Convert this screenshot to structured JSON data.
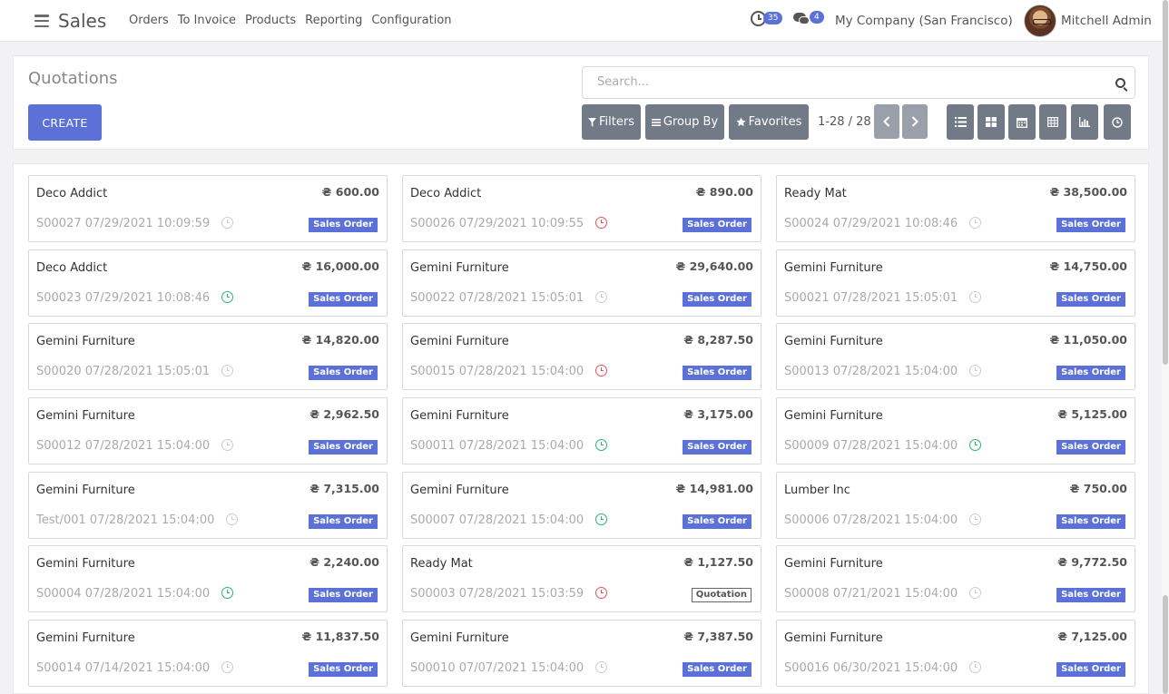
{
  "navbar": {
    "app_name": "Sales",
    "menu": [
      "Orders",
      "To Invoice",
      "Products",
      "Reporting",
      "Configuration"
    ],
    "activity_count": "35",
    "message_count": "4",
    "company": "My Company (San Francisco)",
    "user": "Mitchell Admin"
  },
  "control": {
    "title": "Quotations",
    "create_label": "CREATE",
    "search_placeholder": "Search...",
    "filters_label": "Filters",
    "group_by_label": "Group By",
    "favorites_label": "Favorites",
    "pager": "1-28 / 28"
  },
  "colors": {
    "primary": "#5b71d8",
    "overdue": "#e3545e",
    "planned": "#28b56f",
    "button_gray": "#727987"
  },
  "cards": [
    {
      "name": "Deco Addict",
      "amount": "₴ 600.00",
      "ref": "S00027 07/29/2021 10:09:59",
      "activity": "none",
      "status": "Sales Order"
    },
    {
      "name": "Deco Addict",
      "amount": "₴ 890.00",
      "ref": "S00026 07/29/2021 10:09:55",
      "activity": "overdue",
      "status": "Sales Order"
    },
    {
      "name": "Ready Mat",
      "amount": "₴ 38,500.00",
      "ref": "S00024 07/29/2021 10:08:46",
      "activity": "none",
      "status": "Sales Order"
    },
    {
      "name": "Deco Addict",
      "amount": "₴ 16,000.00",
      "ref": "S00023 07/29/2021 10:08:46",
      "activity": "planned",
      "status": "Sales Order"
    },
    {
      "name": "Gemini Furniture",
      "amount": "₴ 29,640.00",
      "ref": "S00022 07/28/2021 15:05:01",
      "activity": "none",
      "status": "Sales Order"
    },
    {
      "name": "Gemini Furniture",
      "amount": "₴ 14,750.00",
      "ref": "S00021 07/28/2021 15:05:01",
      "activity": "none",
      "status": "Sales Order"
    },
    {
      "name": "Gemini Furniture",
      "amount": "₴ 14,820.00",
      "ref": "S00020 07/28/2021 15:05:01",
      "activity": "none",
      "status": "Sales Order"
    },
    {
      "name": "Gemini Furniture",
      "amount": "₴ 8,287.50",
      "ref": "S00015 07/28/2021 15:04:00",
      "activity": "overdue",
      "status": "Sales Order"
    },
    {
      "name": "Gemini Furniture",
      "amount": "₴ 11,050.00",
      "ref": "S00013 07/28/2021 15:04:00",
      "activity": "none",
      "status": "Sales Order"
    },
    {
      "name": "Gemini Furniture",
      "amount": "₴ 2,962.50",
      "ref": "S00012 07/28/2021 15:04:00",
      "activity": "none",
      "status": "Sales Order"
    },
    {
      "name": "Gemini Furniture",
      "amount": "₴ 3,175.00",
      "ref": "S00011 07/28/2021 15:04:00",
      "activity": "planned",
      "status": "Sales Order"
    },
    {
      "name": "Gemini Furniture",
      "amount": "₴ 5,125.00",
      "ref": "S00009 07/28/2021 15:04:00",
      "activity": "planned",
      "status": "Sales Order"
    },
    {
      "name": "Gemini Furniture",
      "amount": "₴ 7,315.00",
      "ref": "Test/001 07/28/2021 15:04:00",
      "activity": "none",
      "status": "Sales Order"
    },
    {
      "name": "Gemini Furniture",
      "amount": "₴ 14,981.00",
      "ref": "S00007 07/28/2021 15:04:00",
      "activity": "planned",
      "status": "Sales Order"
    },
    {
      "name": "Lumber Inc",
      "amount": "₴ 750.00",
      "ref": "S00006 07/28/2021 15:04:00",
      "activity": "none",
      "status": "Sales Order"
    },
    {
      "name": "Gemini Furniture",
      "amount": "₴ 2,240.00",
      "ref": "S00004 07/28/2021 15:04:00",
      "activity": "planned",
      "status": "Sales Order"
    },
    {
      "name": "Ready Mat",
      "amount": "₴ 1,127.50",
      "ref": "S00003 07/28/2021 15:03:59",
      "activity": "overdue",
      "status": "Quotation"
    },
    {
      "name": "Gemini Furniture",
      "amount": "₴ 9,772.50",
      "ref": "S00008 07/21/2021 15:04:00",
      "activity": "none",
      "status": "Sales Order"
    },
    {
      "name": "Gemini Furniture",
      "amount": "₴ 11,837.50",
      "ref": "S00014 07/14/2021 15:04:00",
      "activity": "none",
      "status": "Sales Order"
    },
    {
      "name": "Gemini Furniture",
      "amount": "₴ 7,387.50",
      "ref": "S00010 07/07/2021 15:04:00",
      "activity": "none",
      "status": "Sales Order"
    },
    {
      "name": "Gemini Furniture",
      "amount": "₴ 7,125.00",
      "ref": "S00016 06/30/2021 15:04:00",
      "activity": "none",
      "status": "Sales Order"
    }
  ]
}
